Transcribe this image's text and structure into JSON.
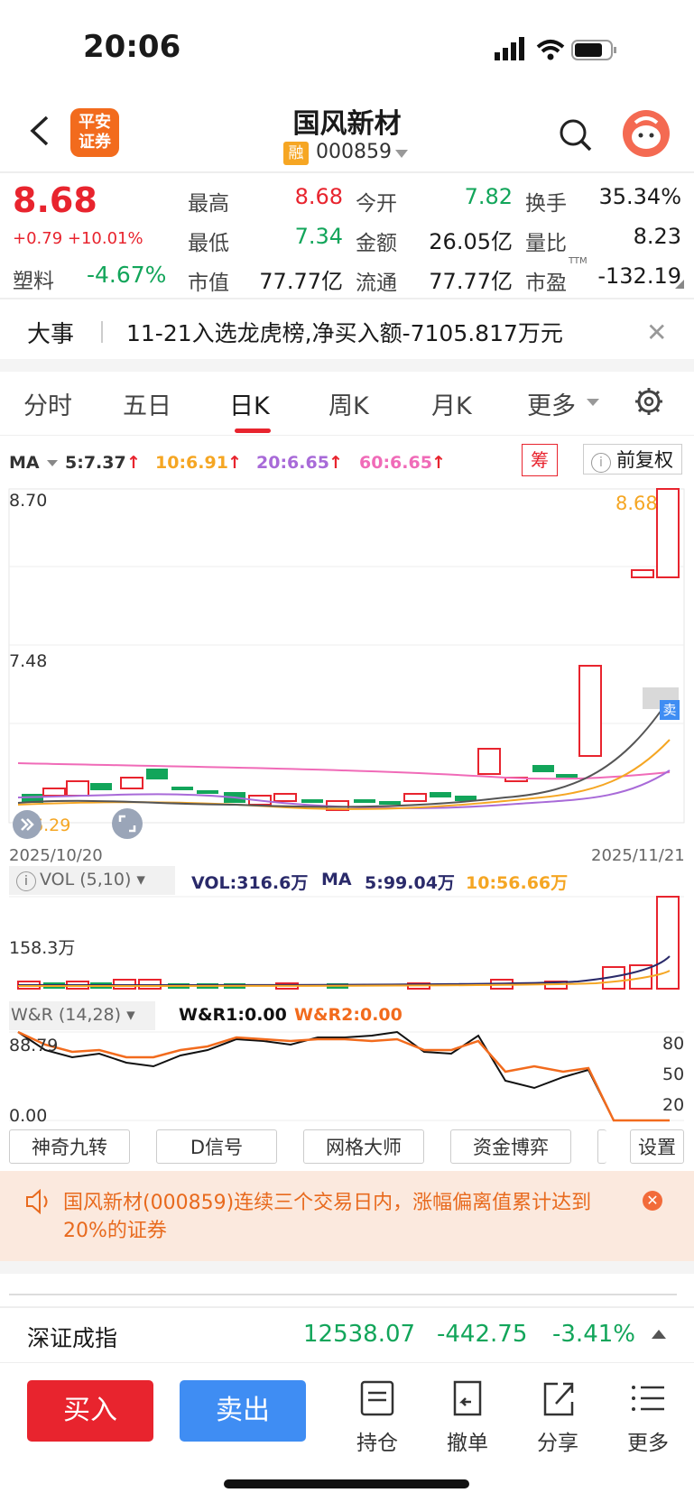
{
  "status": {
    "time": "20:06"
  },
  "header": {
    "logo_line1": "平安",
    "logo_line2": "证券",
    "stock_name": "国风新材",
    "badge": "融",
    "code": "000859"
  },
  "quote": {
    "price": "8.68",
    "change": "+0.79 +10.01%",
    "sector_label": "塑料",
    "sector_change": "-4.67%",
    "rows": [
      [
        {
          "label": "最高",
          "value": "8.68",
          "color": "red"
        },
        {
          "label": "今开",
          "value": "7.82",
          "color": "green"
        },
        {
          "label": "换手",
          "value": "35.34%",
          "color": "black"
        }
      ],
      [
        {
          "label": "最低",
          "value": "7.34",
          "color": "green"
        },
        {
          "label": "金额",
          "value": "26.05亿",
          "color": "black"
        },
        {
          "label": "量比",
          "value": "8.23",
          "color": "black"
        }
      ],
      [
        {
          "label": "市值",
          "value": "77.77亿",
          "color": "black"
        },
        {
          "label": "流通",
          "value": "77.77亿",
          "color": "black"
        },
        {
          "label": "市盈",
          "value": "-132.19",
          "color": "black"
        }
      ]
    ],
    "ttm": "TTM"
  },
  "news": {
    "label": "大事",
    "text": "11-21入选龙虎榜,净买入额-7105.817万元",
    "close": "✕"
  },
  "tabs": [
    "分时",
    "五日",
    "日K",
    "周K",
    "月K",
    "更多"
  ],
  "ma": {
    "label": "MA",
    "items": [
      {
        "text": "5:7.37",
        "color": "#333"
      },
      {
        "text": "10:6.91",
        "color": "#f5a623"
      },
      {
        "text": "20:6.65",
        "color": "#a86ad8"
      },
      {
        "text": "60:6.65",
        "color": "#f06bb8"
      }
    ],
    "chou": "筹",
    "fuquan": "前复权"
  },
  "kline": {
    "y_top": "8.70",
    "y_mid": "7.48",
    "low_label": "6.29",
    "high_label": "8.68",
    "date_start": "2025/10/20",
    "date_end": "2025/11/21",
    "sell_tag": "卖"
  },
  "vol": {
    "selector": "VOL (5,10)",
    "value": "VOL:316.6万",
    "ma_label": "MA",
    "ma5": "5:99.04万",
    "ma10": "10:56.66万",
    "axis": "158.3万"
  },
  "wr": {
    "selector": "W&R (14,28)",
    "wr1": "W&R1:0.00",
    "wr2": "W&R2:0.00",
    "top": "88.79",
    "bottom": "0.00",
    "ticks": [
      "80",
      "50",
      "20"
    ]
  },
  "tools": [
    "神奇九转",
    "D信号",
    "网格大师",
    "资金博弈",
    "设置"
  ],
  "notice": {
    "text": "国风新材(000859)连续三个交易日内，涨幅偏离值累计达到20%的证券"
  },
  "index": {
    "name": "深证成指",
    "value": "12538.07",
    "change": "-442.75",
    "pct": "-3.41%"
  },
  "footer": {
    "buy": "买入",
    "sell": "卖出",
    "items": [
      "持仓",
      "撤单",
      "分享",
      "更多"
    ]
  },
  "colors": {
    "red": "#e8242e",
    "green": "#12a55a",
    "orange": "#f26b1d",
    "blue": "#3f8df3"
  }
}
